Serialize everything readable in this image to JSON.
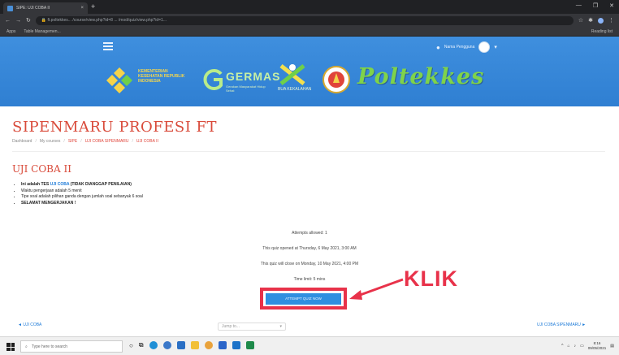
{
  "browser": {
    "tab_title": "SIPE: UJI COBA II",
    "tab_close": "×",
    "new_tab": "+",
    "window_controls": [
      "—",
      "❐",
      "✕"
    ],
    "url": "ft.poltekkes... /course/view.php?id=8 ... /mod/quiz/view.php?id=1...",
    "bookmarks": [
      "Apps",
      "Table Managemen..."
    ],
    "reading_list": "Reading list"
  },
  "site": {
    "user_name": "Nama Pengguna",
    "logos": {
      "kemenkes": "KEMENTERIAN KESEHATAN REPUBLIK INDONESIA",
      "germas": "GERMAS",
      "germas_sub": "Gerakan Masyarakat Hidup Sehat",
      "sehat": "BUA KEKALAHAN",
      "poltekkes": "Poltekkes"
    }
  },
  "page": {
    "title": "SIPENMARU PROFESI FT",
    "breadcrumb": [
      "Dashboard",
      "My courses",
      "SIPE",
      "UJI COBA SIPENMARU",
      "UJI COBA II"
    ],
    "quiz_title": "UJI COBA II",
    "bullets": [
      {
        "pre": "Ini adalah TES ",
        "hl": "UJI COBA",
        "post": " (TIDAK DIANGGAP PENILAIAN)"
      },
      {
        "pre": "Waktu pengerjaan adalah 5 menit",
        "hl": "",
        "post": ""
      },
      {
        "pre": "Tipe soal adalah pilihan ganda dengan jumlah soal sebanyak 6 soal",
        "hl": "",
        "post": ""
      },
      {
        "pre": "SELAMAT MENGERJAKAN !",
        "hl": "",
        "post": ""
      }
    ],
    "info": [
      "Attempts allowed: 1",
      "This quiz opened at Thursday, 6 May 2021, 3:00 AM",
      "This quiz will close on Monday, 10 May 2021, 4:00 PM",
      "Time limit: 5 mins"
    ],
    "attempt_button": "ATTEMPT QUIZ NOW",
    "annotation": "KLIK",
    "prev_link": "◄ UJI COBA",
    "jump_to": "Jump to...",
    "next_link": "UJI COBA SIPENMARU ►"
  },
  "taskbar": {
    "search_placeholder": "Type here to search",
    "time": "8:16",
    "date": "09/05/2021"
  },
  "colors": {
    "header_blue": "#3588da",
    "accent_red": "#d94b3b",
    "button_blue": "#2f8fe0",
    "annotation_red": "#e8324a"
  }
}
